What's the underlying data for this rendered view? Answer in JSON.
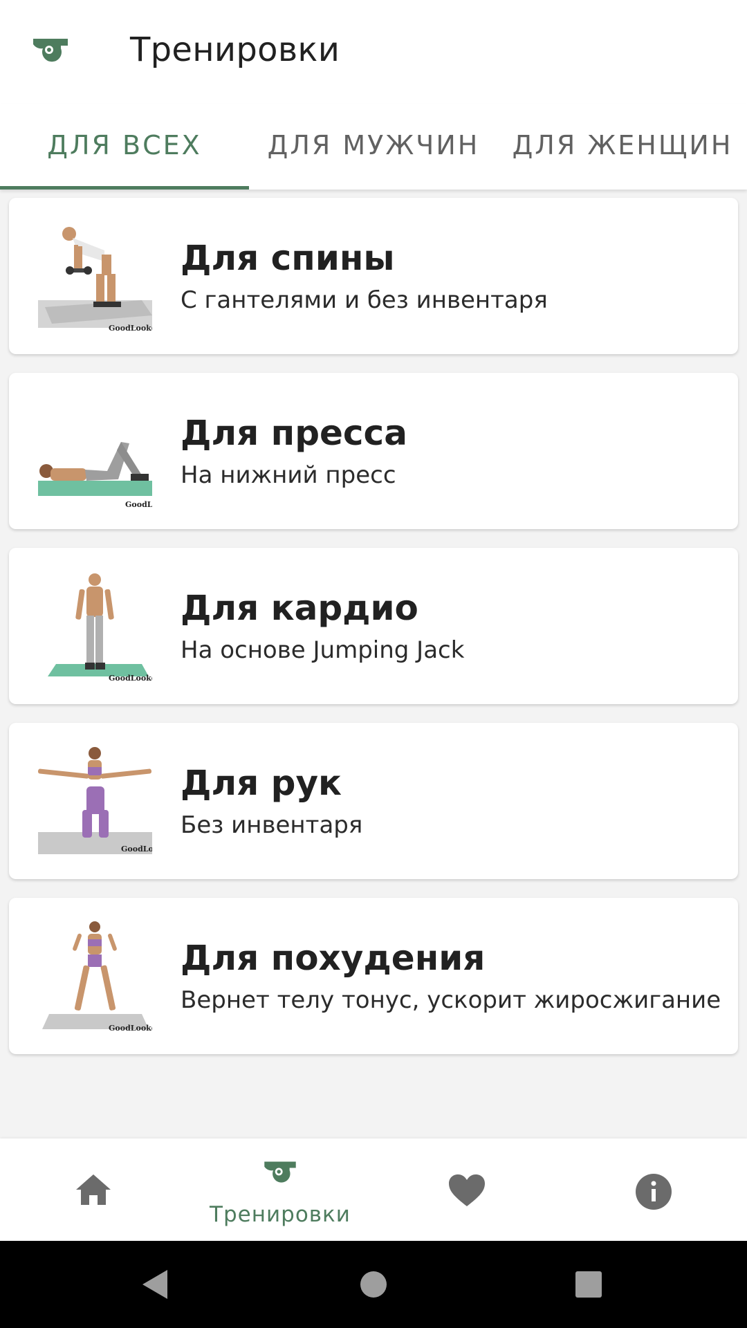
{
  "app_bar": {
    "title": "Тренировки",
    "icon": "whistle-icon"
  },
  "tabs": [
    {
      "label": "Для всех",
      "active": true
    },
    {
      "label": "Для мужчин",
      "active": false
    },
    {
      "label": "Для женщин",
      "active": false
    }
  ],
  "workouts": [
    {
      "title": "Для спины",
      "subtitle": "С гантелями и без инвентаря",
      "image": "back-workout-image",
      "watermark": "GoodLooker"
    },
    {
      "title": "Для пресса",
      "subtitle": "На нижний пресс",
      "image": "abs-workout-image",
      "watermark": "GoodL"
    },
    {
      "title": "Для кардио",
      "subtitle": "На основе Jumping Jack",
      "image": "cardio-workout-image",
      "watermark": "GoodLooker"
    },
    {
      "title": "Для рук",
      "subtitle": "Без инвентаря",
      "image": "arms-workout-image",
      "watermark": "GoodLo"
    },
    {
      "title": "Для похудения",
      "subtitle": "Вернет телу тонус, ускорит жиросжигание",
      "image": "weight-loss-workout-image",
      "watermark": "GoodLooker"
    }
  ],
  "bottom_nav": {
    "items": [
      {
        "icon": "home-icon",
        "label": ""
      },
      {
        "icon": "whistle-icon",
        "label": "Тренировки",
        "active": true
      },
      {
        "icon": "heart-icon",
        "label": ""
      },
      {
        "icon": "info-icon",
        "label": ""
      }
    ]
  },
  "colors": {
    "accent": "#4e7c5e",
    "text": "#212121",
    "inactive_tab": "#616161",
    "background": "#f3f3f3"
  }
}
